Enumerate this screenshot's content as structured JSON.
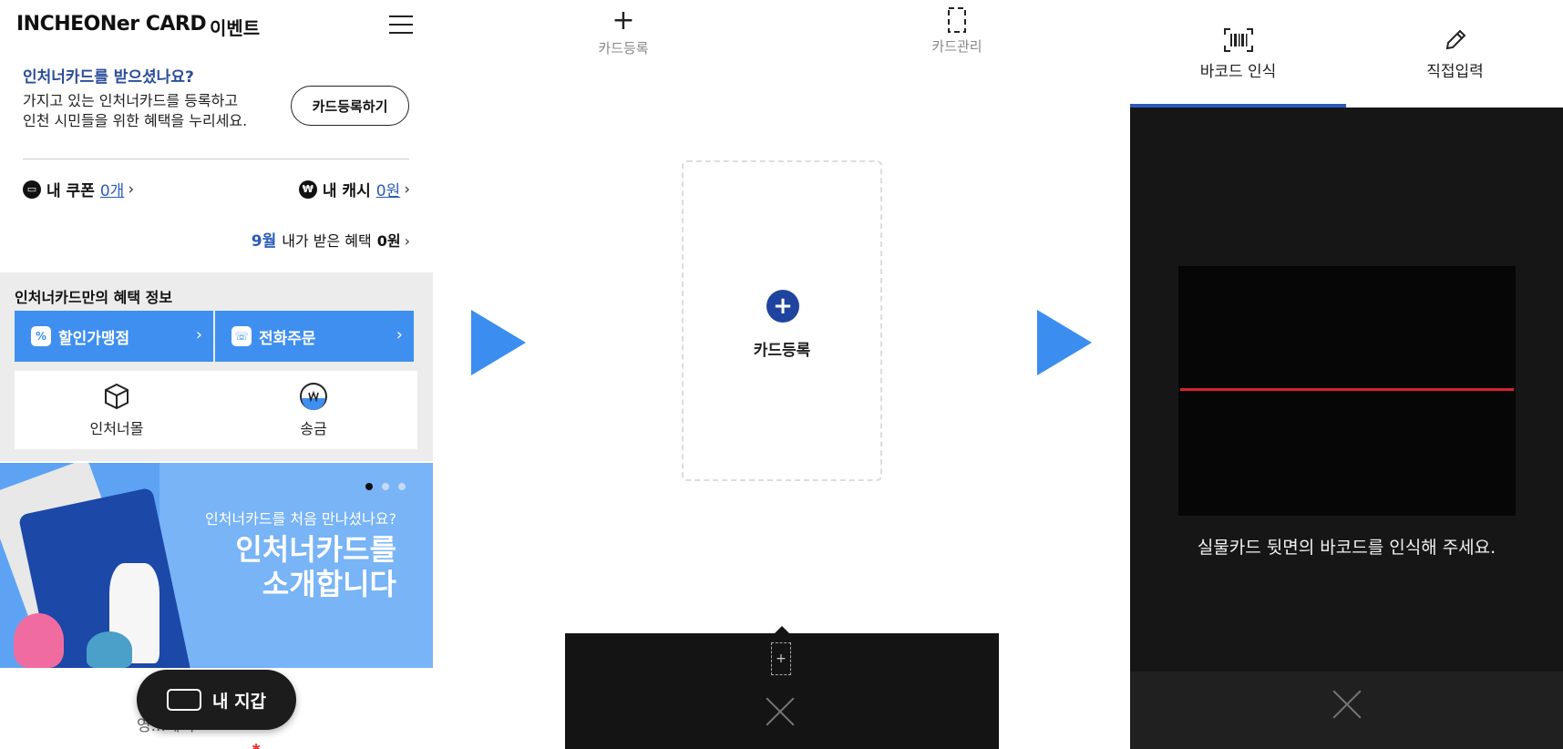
{
  "panel1": {
    "header": {
      "brand": "INCHEONer CARD",
      "event_link": "이벤트",
      "menu_icon": "hamburger-menu-icon"
    },
    "promo": {
      "question": "인처너카드를 받으셨나요?",
      "desc_line1": "가지고 있는 인처너카드를 등록하고",
      "desc_line2": "인천 시민들을 위한 혜택을 누리세요.",
      "register_button": "카드등록하기"
    },
    "wallet_summary": {
      "coupon_label": "내 쿠폰",
      "coupon_value": "0개",
      "cash_label": "내 캐시",
      "cash_value": "0원",
      "month": "9월",
      "benefit_label": "내가 받은 혜택",
      "benefit_amount": "0원"
    },
    "benefits": {
      "title": "인처너카드만의 혜택 정보",
      "discount_store": "할인가맹점",
      "phone_order": "전화주문",
      "mall": "인처너몰",
      "transfer": "송금"
    },
    "banner": {
      "subtitle": "인처너카드를 처음 만나셨나요?",
      "title_line1": "인처너카드를",
      "title_line2": "소개합니다"
    },
    "wallet_button": "내 지갑",
    "bottom_partial_text": "영...혜택"
  },
  "panel2": {
    "tabs": {
      "register": "카드등록",
      "manage": "카드관리"
    },
    "card_slot_label": "카드등록",
    "mini_card_symbol": "+"
  },
  "panel3": {
    "tabs": {
      "barcode": "바코드 인식",
      "manual": "직접입력"
    },
    "scan_message": "실물카드 뒷면의 바코드를 인식해 주세요."
  },
  "colors": {
    "brand_blue": "#2a5bb8",
    "button_blue": "#3e8ff0",
    "scan_red": "#d6222b",
    "arrow_blue": "#3b8ef0"
  }
}
